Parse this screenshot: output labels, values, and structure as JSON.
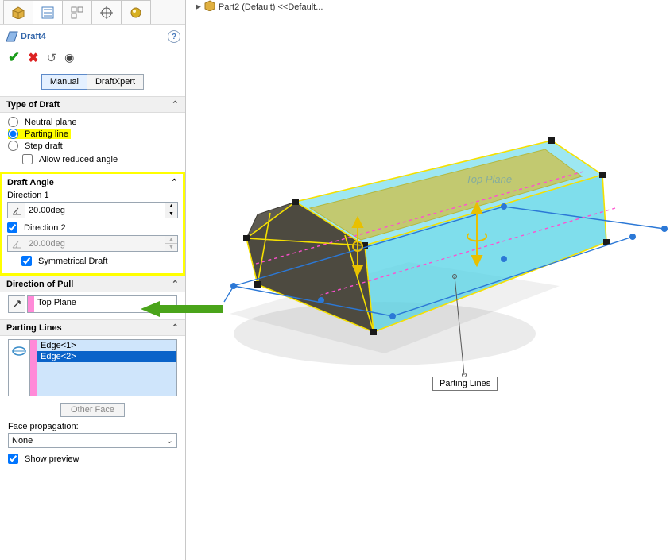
{
  "breadcrumb": {
    "label": "Part2 (Default) <<Default..."
  },
  "feature": {
    "title": "Draft4"
  },
  "modes": {
    "manual": "Manual",
    "draftxpert": "DraftXpert"
  },
  "typeOfDraft": {
    "header": "Type of Draft",
    "neutral": "Neutral plane",
    "parting": "Parting line",
    "step": "Step draft",
    "allowReduced": "Allow reduced angle"
  },
  "draftAngle": {
    "header": "Draft Angle",
    "dir1Label": "Direction 1",
    "dir1Value": "20.00deg",
    "dir2Label": "Direction 2",
    "dir2Value": "20.00deg",
    "symmetrical": "Symmetrical Draft"
  },
  "directionOfPull": {
    "header": "Direction of Pull",
    "value": "Top Plane"
  },
  "partingLines": {
    "header": "Parting Lines",
    "items": [
      "Edge<1>",
      "Edge<2>"
    ],
    "otherFace": "Other Face",
    "facePropLabel": "Face propagation:",
    "facePropValue": "None",
    "showPreview": "Show preview"
  },
  "viewport": {
    "tooltip": "Parting Lines",
    "planeLabel": "Top Plane"
  }
}
